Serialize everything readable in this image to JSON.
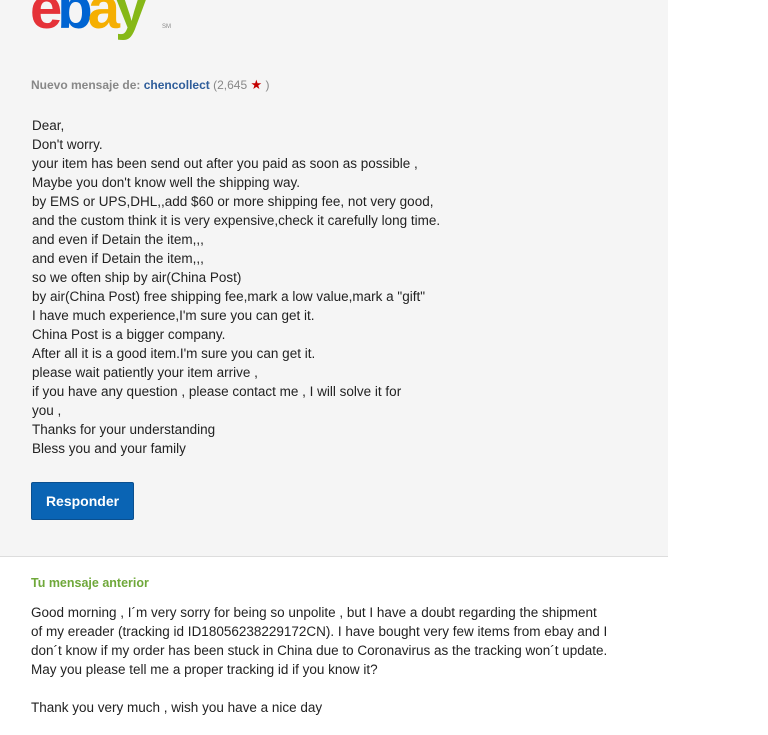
{
  "logo": {
    "letters": [
      "e",
      "b",
      "a",
      "y"
    ],
    "colors": [
      "#e53238",
      "#0064d2",
      "#f5af02",
      "#86b817"
    ],
    "tm": "SM"
  },
  "message": {
    "header_prefix": "Nuevo mensaje de:",
    "sender": "chencollect",
    "feedback_open": "(2,645",
    "feedback_close": ")",
    "lines": [
      "Dear,",
      "Don't worry.",
      "your item has been send out after you paid as soon as possible ,",
      "Maybe you don't know well the shipping way.",
      "by EMS or UPS,DHL,,add $60 or more shipping fee, not very good,",
      "and the custom think it is very expensive,check it carefully long time.",
      "and even if Detain the item,,,",
      "and even if Detain the item,,,",
      "so we often ship by air(China Post)",
      "by air(China Post) free shipping fee,mark a low value,mark a \"gift\"",
      "I have much experience,I'm sure you can get it.",
      "China Post is a bigger company.",
      "After all it is a good item.I'm sure you can get it.",
      "please wait patiently your item arrive ,",
      "if you have any question , please contact me , I will solve it for",
      "you ,",
      "Thanks for your understanding",
      "Bless you and your family"
    ],
    "reply_label": "Responder"
  },
  "previous": {
    "title": "Tu mensaje anterior",
    "lines": [
      "Good morning , I´m very sorry for being so unpolite , but I have a doubt regarding the shipment",
      "of my ereader (tracking id ID18056238229172CN). I have bought very few items from ebay and I",
      "don´t know if my order has been stuck in China due to Coronavirus as the tracking won´t update.",
      "May you please tell me a proper tracking id if you know it?",
      "",
      "Thank you very much , wish you have a nice day"
    ]
  }
}
